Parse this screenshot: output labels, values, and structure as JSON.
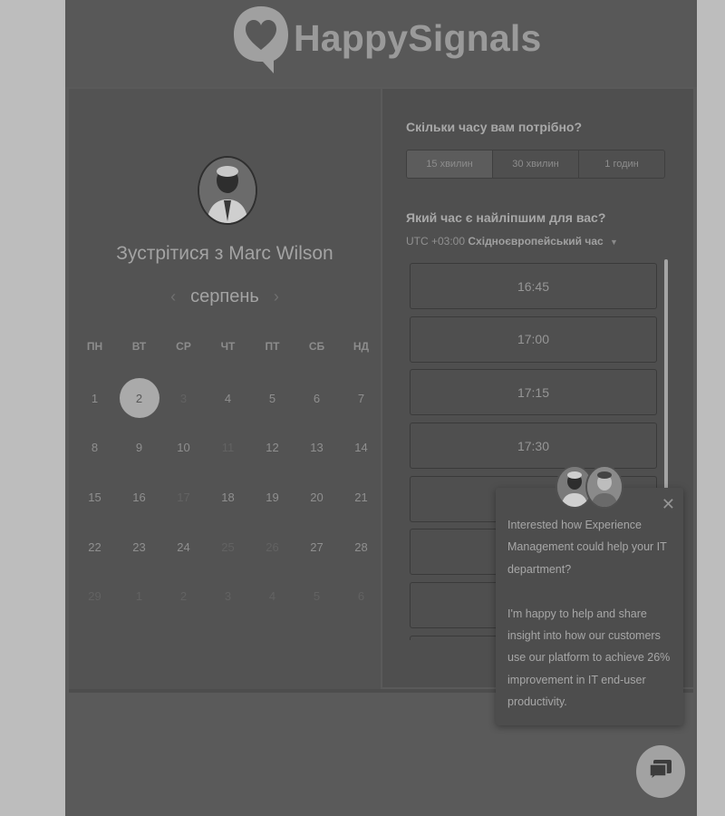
{
  "brand": {
    "name": "HappySignals"
  },
  "scheduler": {
    "title_prefix": "Зустрітися з",
    "host_name": "Marc Wilson",
    "month": "серпень",
    "weekdays": [
      "ПН",
      "ВТ",
      "СР",
      "ЧТ",
      "ПТ",
      "СБ",
      "НД"
    ],
    "days": [
      {
        "label": "1",
        "muted": false
      },
      {
        "label": "2",
        "muted": false,
        "selected": true
      },
      {
        "label": "3",
        "muted": true
      },
      {
        "label": "4",
        "muted": false
      },
      {
        "label": "5",
        "muted": false
      },
      {
        "label": "6",
        "muted": false
      },
      {
        "label": "7",
        "muted": false
      },
      {
        "label": "8",
        "muted": false
      },
      {
        "label": "9",
        "muted": false
      },
      {
        "label": "10",
        "muted": false
      },
      {
        "label": "11",
        "muted": true
      },
      {
        "label": "12",
        "muted": false
      },
      {
        "label": "13",
        "muted": false
      },
      {
        "label": "14",
        "muted": false
      },
      {
        "label": "15",
        "muted": false
      },
      {
        "label": "16",
        "muted": false
      },
      {
        "label": "17",
        "muted": true
      },
      {
        "label": "18",
        "muted": false
      },
      {
        "label": "19",
        "muted": false
      },
      {
        "label": "20",
        "muted": false
      },
      {
        "label": "21",
        "muted": false
      },
      {
        "label": "22",
        "muted": false
      },
      {
        "label": "23",
        "muted": false
      },
      {
        "label": "24",
        "muted": false
      },
      {
        "label": "25",
        "muted": true
      },
      {
        "label": "26",
        "muted": true
      },
      {
        "label": "27",
        "muted": false
      },
      {
        "label": "28",
        "muted": false
      },
      {
        "label": "29",
        "muted": true
      },
      {
        "label": "1",
        "muted": true
      },
      {
        "label": "2",
        "muted": true
      },
      {
        "label": "3",
        "muted": true
      },
      {
        "label": "4",
        "muted": true
      },
      {
        "label": "5",
        "muted": true
      },
      {
        "label": "6",
        "muted": true
      }
    ],
    "duration_question": "Скільки часу вам потрібно?",
    "durations": [
      "15 хвилин",
      "30 хвилин",
      "1 годин"
    ],
    "active_duration": 0,
    "time_question": "Який час є найліпшим для вас?",
    "timezone_offset": "UTC +03:00",
    "timezone_name": "Східноєвропейський час",
    "slots": [
      "16:45",
      "17:00",
      "17:15",
      "17:30",
      "",
      "",
      "",
      ""
    ]
  },
  "popup": {
    "paragraph1": "Interested how Experience Management could help your IT department?",
    "paragraph2": "I'm happy to help and share insight into how our customers use our platform to achieve 26% improvement in IT end-user productivity."
  },
  "icons": [
    "logo-heart-bubble-icon",
    "close-icon",
    "chat-bubble-icon",
    "chevron-left-icon",
    "chevron-right-icon",
    "caret-down-icon"
  ]
}
